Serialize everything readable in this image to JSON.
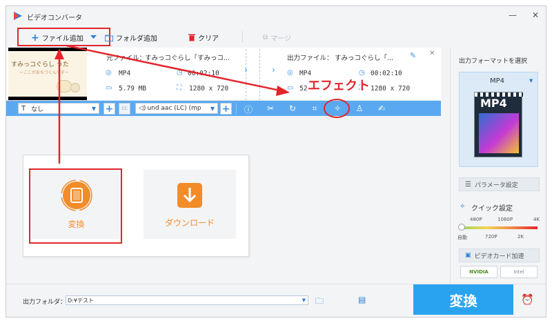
{
  "titlebar": {
    "title": "ビデオコンバータ",
    "minimize": "—",
    "close": "✕"
  },
  "toolbar": {
    "add_file": "ファイル追加",
    "add_folder": "フォルダ追加",
    "clear": "クリア",
    "merge": "マージ"
  },
  "file": {
    "source_label": "元ファイル：",
    "source_name": "すみっコぐらし「すみっコ...",
    "source_format": "MP4",
    "source_duration": "00:02:10",
    "source_size": "5.79 MB",
    "source_res": "1280 x 720",
    "output_label": "出力ファイル：",
    "output_name": "すみっコぐらし「...",
    "output_format": "MP4",
    "output_duration": "00:02:10",
    "output_size": "52",
    "output_res": "1280 x 720",
    "thumb_title": "すみっコぐらし うた",
    "thumb_sub": "ーここがおちつくんですー"
  },
  "editbar": {
    "subtitle": "なし",
    "audio": "und aac (LC) (mp",
    "cc": "CC"
  },
  "annotation": {
    "effect": "エフェクト"
  },
  "main": {
    "convert_tile": "変換",
    "download_tile": "ダウンロード"
  },
  "right": {
    "format_heading": "出力フォーマットを選択",
    "format": "MP4",
    "format_icon_text": "MP4",
    "param_settings": "パラメータ設定",
    "quick_settings": "クイック設定",
    "quality_top": [
      "480P",
      "1080P",
      "4K"
    ],
    "quality_bottom": [
      "自動",
      "720P",
      "2K"
    ],
    "gpu_accel": "ビデオカード加速",
    "nvidia": "NVIDIA",
    "intel": "Intel"
  },
  "bottom": {
    "output_folder_label": "出力フォルダ：",
    "output_folder_value": "D:¥テスト",
    "convert_button": "変換"
  },
  "colors": {
    "accent_blue": "#29a3ee",
    "highlight_red": "#e3242b",
    "orange": "#f28c28"
  }
}
